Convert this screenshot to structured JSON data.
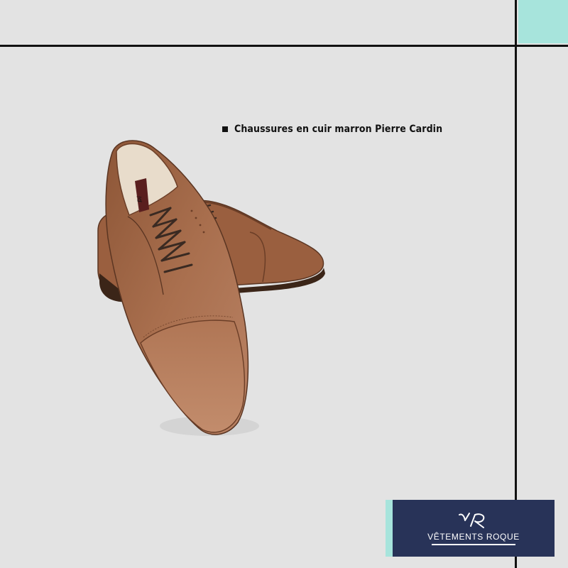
{
  "colors": {
    "background": "#e3e3e3",
    "line": "#111111",
    "accent": "#a7e4dc",
    "brand_navy": "#283358",
    "leather": "#a0684a"
  },
  "caption": {
    "text": "Chaussures en cuir marron Pierre Cardin"
  },
  "logo": {
    "text": "VÊTEMENTS ROQUE",
    "icon": "vr-monogram-icon"
  },
  "product_image": {
    "icon": "brown-leather-oxford-shoes"
  }
}
